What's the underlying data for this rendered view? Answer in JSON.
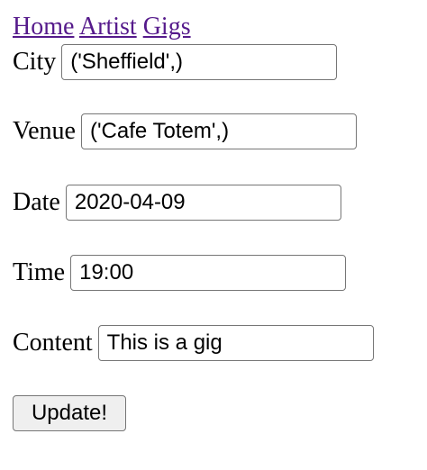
{
  "nav": {
    "links": [
      "Home",
      "Artist",
      "Gigs"
    ]
  },
  "form": {
    "city": {
      "label": "City",
      "value": "('Sheffield',)"
    },
    "venue": {
      "label": "Venue",
      "value": "('Cafe Totem',)"
    },
    "date": {
      "label": "Date",
      "value": "2020-04-09"
    },
    "time": {
      "label": "Time",
      "value": "19:00"
    },
    "content": {
      "label": "Content",
      "value": "This is a gig"
    },
    "submit_label": "Update!"
  },
  "colors": {
    "link": "#551a8b",
    "input_border": "#767676",
    "button_bg": "#efefef"
  }
}
